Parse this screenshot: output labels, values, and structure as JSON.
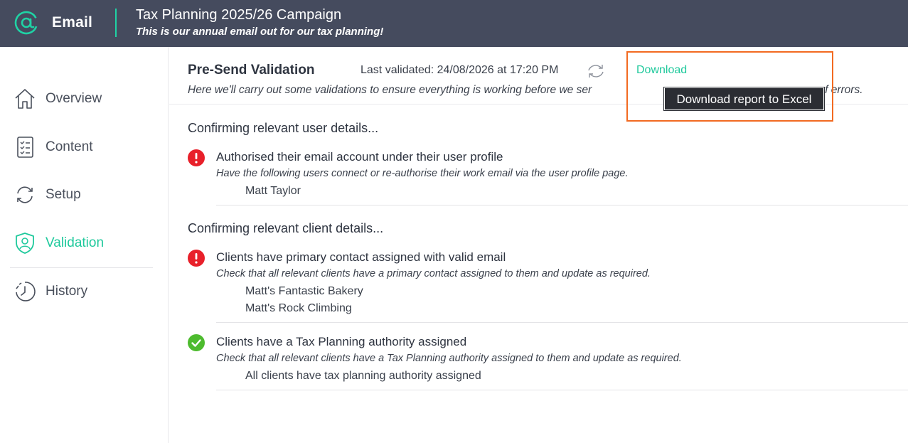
{
  "header": {
    "app_icon": "at-sign-icon",
    "app_name": "Email",
    "campaign_title": "Tax Planning 2025/26 Campaign",
    "campaign_subtitle": "This is our annual email out for our tax planning!",
    "accent_color": "#1fd3a5",
    "background_color": "#454b5e"
  },
  "sidebar": {
    "items": [
      {
        "label": "Overview",
        "icon": "home-icon",
        "active": false
      },
      {
        "label": "Content",
        "icon": "checklist-icon",
        "active": false
      },
      {
        "label": "Setup",
        "icon": "sync-icon",
        "active": false
      },
      {
        "label": "Validation",
        "icon": "shield-user-icon",
        "active": true
      },
      {
        "label": "History",
        "icon": "clock-icon",
        "active": false
      }
    ]
  },
  "main": {
    "title": "Pre-Send Validation",
    "last_validated": "Last validated: 24/08/2026 at 17:20 PM",
    "refresh_icon": "refresh-icon",
    "download_label": "Download",
    "tooltip": "Download report to Excel",
    "intro_visible_start": "Here we'll carry out some validations to ensure everything is working before we ser",
    "intro_visible_end": "f errors.",
    "highlight_color": "#f26a21",
    "groups": [
      {
        "title": "Confirming relevant user details...",
        "checks": [
          {
            "status": "error",
            "status_icon": "error-icon",
            "title": "Authorised their email account under their user profile",
            "description": "Have the following users connect or re-authorise their work email via the user profile page.",
            "items": [
              "Matt Taylor"
            ]
          }
        ]
      },
      {
        "title": "Confirming relevant client details...",
        "checks": [
          {
            "status": "error",
            "status_icon": "error-icon",
            "title": "Clients have primary contact assigned with valid email",
            "description": "Check that all relevant clients have a primary contact assigned to them and update as required.",
            "items": [
              "Matt's Fantastic Bakery",
              "Matt's Rock Climbing"
            ]
          },
          {
            "status": "success",
            "status_icon": "check-circle-icon",
            "title": "Clients have a Tax Planning authority assigned",
            "description": "Check that all relevant clients have a Tax Planning authority assigned to them and update as required.",
            "items": [
              "All clients have tax planning authority assigned"
            ]
          }
        ]
      }
    ],
    "error_color": "#e8202a",
    "success_color": "#4dbb2e"
  }
}
